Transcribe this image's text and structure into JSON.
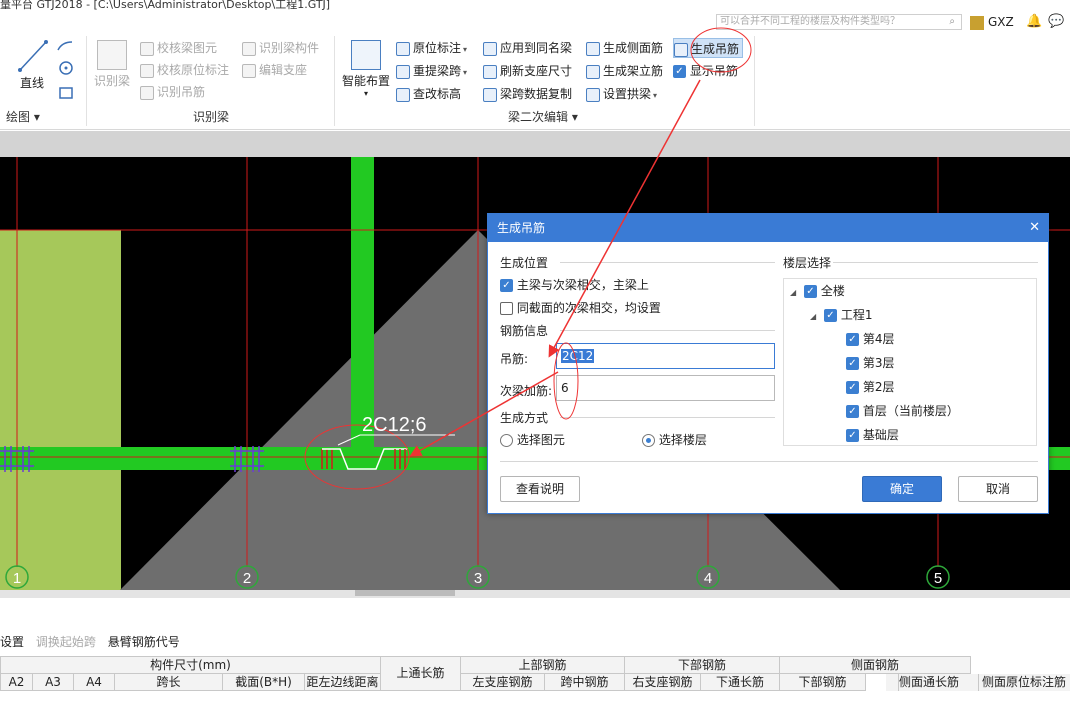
{
  "titlebar": {
    "text": "量平台 GTJ2018 - [C:\\Users\\Administrator\\Desktop\\工程1.GTJ]"
  },
  "search": {
    "placeholder": "可以合并不同工程的楼层及构件类型吗？",
    "icon": "search-icon"
  },
  "user": {
    "name": "GXZ",
    "icons": [
      "bell-icon",
      "chat-icon"
    ]
  },
  "ribbon": {
    "draw": {
      "line_label": "直线",
      "group_label": "绘图"
    },
    "identify": {
      "big_label": "识别梁",
      "items": [
        "校核梁图元",
        "识别梁构件",
        "校核原位标注",
        "编辑支座",
        "识别吊筋"
      ],
      "group_label": "识别梁"
    },
    "smart": {
      "label": "智能布置"
    },
    "edit2": {
      "col1": [
        "原位标注",
        "重提梁跨",
        "查改标高"
      ],
      "col2": [
        "应用到同名梁",
        "刷新支座尺寸",
        "梁跨数据复制"
      ],
      "col3": [
        "生成侧面筋",
        "生成架立筋",
        "设置拱梁"
      ],
      "col4": [
        "生成吊筋",
        "显示吊筋"
      ],
      "group_label": "梁二次编辑"
    }
  },
  "canvas": {
    "annotation": "2C12;6",
    "axis_labels": [
      "1",
      "2",
      "3",
      "4",
      "5"
    ],
    "colors": {
      "beam": "#22c922",
      "axis": "#d11a1a",
      "slab": "#a6c85a",
      "shade": "#6e6e6e"
    }
  },
  "dialog": {
    "title": "生成吊筋",
    "position_section": "生成位置",
    "opt_main": "主梁与次梁相交，主梁上",
    "opt_same": "同截面的次梁相交，均设置",
    "rebar_section": "钢筋信息",
    "hanger_label": "吊筋:",
    "hanger_value": "2C12",
    "extra_label": "次梁加筋:",
    "extra_value": "6",
    "method_section": "生成方式",
    "method_elem": "选择图元",
    "method_floor": "选择楼层",
    "floor_section": "楼层选择",
    "tree": [
      "全楼",
      "工程1",
      "第4层",
      "第3层",
      "第2层",
      "首层（当前楼层）",
      "基础层"
    ],
    "help_btn": "查看说明",
    "ok_btn": "确定",
    "cancel_btn": "取消"
  },
  "bottom": {
    "toolbar": [
      "设置",
      "调换起始跨",
      "悬臂钢筋代号"
    ],
    "group_headers": [
      "构件尺寸(mm)",
      "上通长筋",
      "上部钢筋",
      "下部钢筋",
      "侧面钢筋"
    ],
    "columns": [
      "A2",
      "A3",
      "A4",
      "跨长",
      "截面(B*H)",
      "距左边线距离",
      "左支座钢筋",
      "跨中钢筋",
      "右支座钢筋",
      "下通长筋",
      "下部钢筋",
      "侧面通长筋",
      "侧面原位标注筋"
    ]
  }
}
